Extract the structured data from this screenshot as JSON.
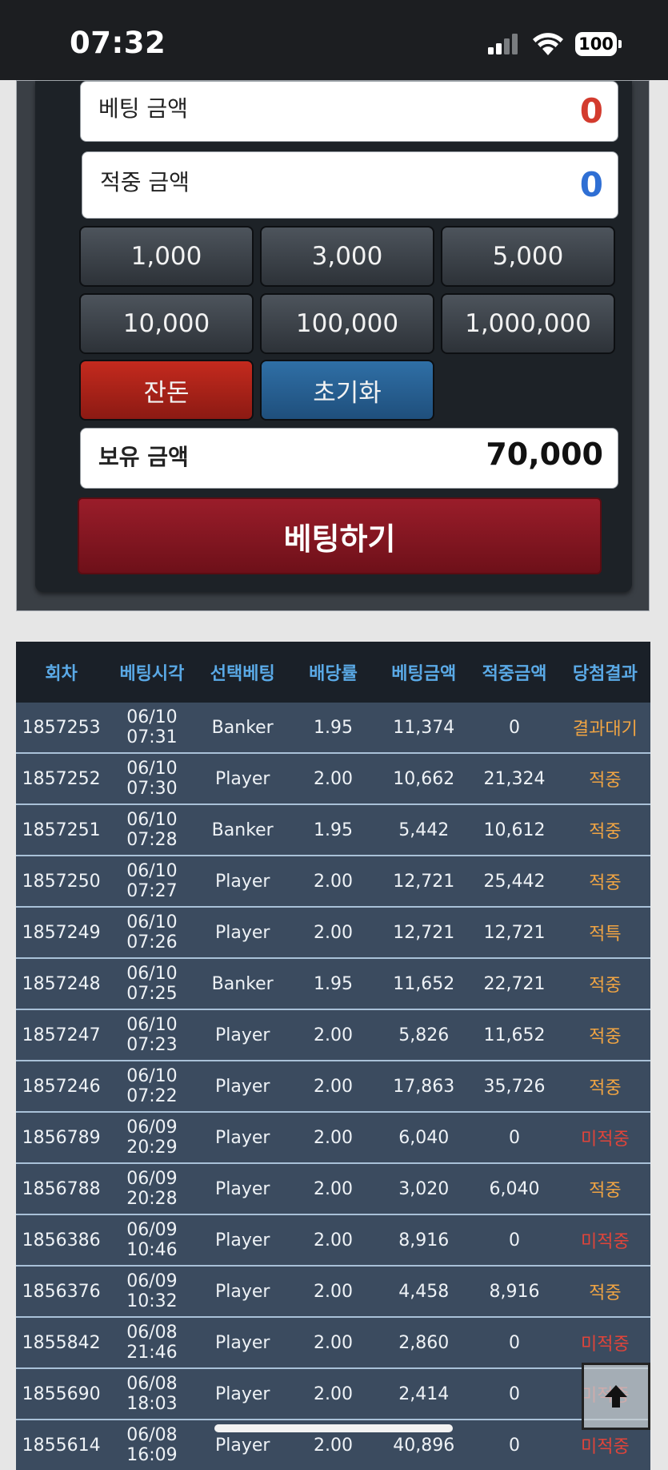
{
  "status_bar": {
    "time": "07:32",
    "battery": "100"
  },
  "betting_panel": {
    "bet_amount": {
      "label": "베팅 금액",
      "value": "0"
    },
    "hit_amount": {
      "label": "적중 금액",
      "value": "0"
    },
    "chips": [
      "1,000",
      "3,000",
      "5,000",
      "10,000",
      "100,000",
      "1,000,000"
    ],
    "change_label": "잔돈",
    "reset_label": "초기화",
    "balance": {
      "label": "보유 금액",
      "value": "70,000"
    },
    "bet_button_label": "베팅하기"
  },
  "history": {
    "columns": [
      "회차",
      "베팅시각",
      "선택베팅",
      "배당률",
      "베팅금액",
      "적중금액",
      "당첨결과"
    ],
    "rows": [
      [
        "1857253",
        "06/10 07:31",
        "Banker",
        "1.95",
        "11,374",
        "0",
        "결과대기"
      ],
      [
        "1857252",
        "06/10 07:30",
        "Player",
        "2.00",
        "10,662",
        "21,324",
        "적중"
      ],
      [
        "1857251",
        "06/10 07:28",
        "Banker",
        "1.95",
        "5,442",
        "10,612",
        "적중"
      ],
      [
        "1857250",
        "06/10 07:27",
        "Player",
        "2.00",
        "12,721",
        "25,442",
        "적중"
      ],
      [
        "1857249",
        "06/10 07:26",
        "Player",
        "2.00",
        "12,721",
        "12,721",
        "적특"
      ],
      [
        "1857248",
        "06/10 07:25",
        "Banker",
        "1.95",
        "11,652",
        "22,721",
        "적중"
      ],
      [
        "1857247",
        "06/10 07:23",
        "Player",
        "2.00",
        "5,826",
        "11,652",
        "적중"
      ],
      [
        "1857246",
        "06/10 07:22",
        "Player",
        "2.00",
        "17,863",
        "35,726",
        "적중"
      ],
      [
        "1856789",
        "06/09 20:29",
        "Player",
        "2.00",
        "6,040",
        "0",
        "미적중"
      ],
      [
        "1856788",
        "06/09 20:28",
        "Player",
        "2.00",
        "3,020",
        "6,040",
        "적중"
      ],
      [
        "1856386",
        "06/09 10:46",
        "Player",
        "2.00",
        "8,916",
        "0",
        "미적중"
      ],
      [
        "1856376",
        "06/09 10:32",
        "Player",
        "2.00",
        "4,458",
        "8,916",
        "적중"
      ],
      [
        "1855842",
        "06/08 21:46",
        "Player",
        "2.00",
        "2,860",
        "0",
        "미적중"
      ],
      [
        "1855690",
        "06/08 18:03",
        "Player",
        "2.00",
        "2,414",
        "0",
        "미적중"
      ],
      [
        "1855614",
        "06/08 16:09",
        "Player",
        "2.00",
        "40,896",
        "0",
        "미적중"
      ]
    ]
  },
  "colors": {
    "win": "#f0a443",
    "lose": "#e0443a",
    "header_text": "#5aa9e6"
  }
}
